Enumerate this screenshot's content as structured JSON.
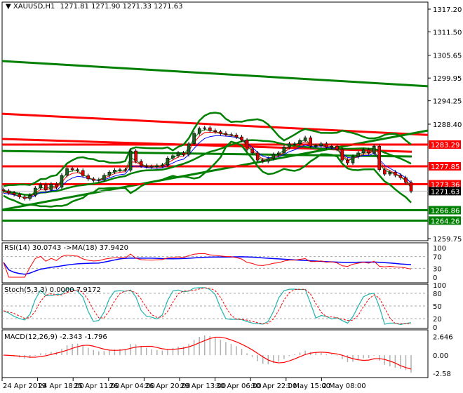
{
  "header": {
    "symbol": "XAUUSD,H1",
    "ohlc": "1271.81 1271.90 1271.33 1271.63"
  },
  "colors": {
    "bull": "#1e5e1e",
    "bear": "#e60000",
    "red_line": "#ff0000",
    "green_line": "#008000",
    "ma_blue": "#0000ff",
    "rsi": "#ff0000",
    "rsi_ma": "#0000ff",
    "stoch_main": "#20b2aa",
    "stoch_signal": "#ff0000",
    "macd_hist": "#b0b0b0",
    "macd_signal": "#ff0000"
  },
  "chart_data": [
    {
      "type": "candlestick",
      "title": "XAUUSD,H1",
      "ylim": [
        1259.75,
        1317.2
      ],
      "y_ticks": [
        "1317.20",
        "1311.50",
        "1305.65",
        "1299.95",
        "1294.25",
        "1288.40",
        "1259.75"
      ],
      "closes": [
        1271.7,
        1271.2,
        1270.8,
        1270.2,
        1269.8,
        1270.6,
        1272.4,
        1273.3,
        1272.0,
        1273.4,
        1272.6,
        1275.6,
        1277.3,
        1277.0,
        1276.8,
        1275.5,
        1274.7,
        1274.3,
        1274.5,
        1275.6,
        1276.4,
        1276.9,
        1277.0,
        1276.9,
        1281.7,
        1279.1,
        1278.0,
        1277.8,
        1277.7,
        1278.0,
        1278.2,
        1279.9,
        1280.5,
        1281.2,
        1280.8,
        1283.5,
        1286.1,
        1287.3,
        1287.5,
        1286.8,
        1286.5,
        1286.1,
        1285.8,
        1285.7,
        1285.2,
        1284.4,
        1282.1,
        1281.2,
        1279.4,
        1279.1,
        1279.8,
        1280.8,
        1281.2,
        1282.6,
        1283.5,
        1283.5,
        1284.3,
        1285.0,
        1282.9,
        1283.0,
        1283.5,
        1282.6,
        1282.9,
        1282.1,
        1279.4,
        1278.7,
        1280.3,
        1281.2,
        1282.0,
        1281.2,
        1282.9,
        1277.0,
        1275.9,
        1276.4,
        1275.6,
        1275.0,
        1273.8,
        1271.63
      ],
      "horizontal_levels": [
        {
          "price": 1283.29,
          "label": "1283.29",
          "color": "red"
        },
        {
          "price": 1277.85,
          "label": "1277.85",
          "color": "red"
        },
        {
          "price": 1273.36,
          "label": "1273.36",
          "color": "red"
        },
        {
          "price": 1266.86,
          "label": "1266.86",
          "color": "green"
        },
        {
          "price": 1264.26,
          "label": "1264.26",
          "color": "green"
        }
      ],
      "current_price": {
        "price": 1271.63,
        "label": "1271.63"
      },
      "trendlines": [
        {
          "color": "red",
          "start": 1291.0,
          "end": 1285.7
        },
        {
          "color": "red",
          "start": 1284.7,
          "end": 1281.5,
          "partial": true
        },
        {
          "color": "green",
          "start": 1304.2,
          "end": 1297.9
        },
        {
          "color": "green",
          "start": 1266.95,
          "end": 1286.8
        },
        {
          "color": "green",
          "start": 1281.7,
          "end": 1280.3,
          "partial": true
        }
      ],
      "x_labels": [
        "24 Apr 2019",
        "24 Apr 18:00",
        "25 Apr 11:00",
        "26 Apr 04:00",
        "26 Apr 20:00",
        "29 Apr 13:00",
        "30 Apr 06:00",
        "30 Apr 22:00",
        "1 May 15:00",
        "2 May 08:00"
      ]
    },
    {
      "type": "line",
      "title": "RSI(14) 30.0743  ->MA(18) 37.9420",
      "ylim": [
        0,
        100
      ],
      "y_ticks": [
        "100",
        "70",
        "30",
        "0"
      ],
      "levels": [
        70,
        30
      ]
    },
    {
      "type": "line",
      "title": "Stoch(5,3,3) 0.0000 7.9172",
      "ylim": [
        0,
        100
      ],
      "y_ticks": [
        "100",
        "80",
        "50",
        "20",
        "0"
      ],
      "levels": [
        80,
        50,
        20
      ]
    },
    {
      "type": "bar",
      "title": "MACD(12,26,9) -2.343 -1.796",
      "ylim": [
        -2.58,
        2.646
      ],
      "y_ticks": [
        "2.646",
        "0.00",
        "-2.58"
      ]
    }
  ]
}
